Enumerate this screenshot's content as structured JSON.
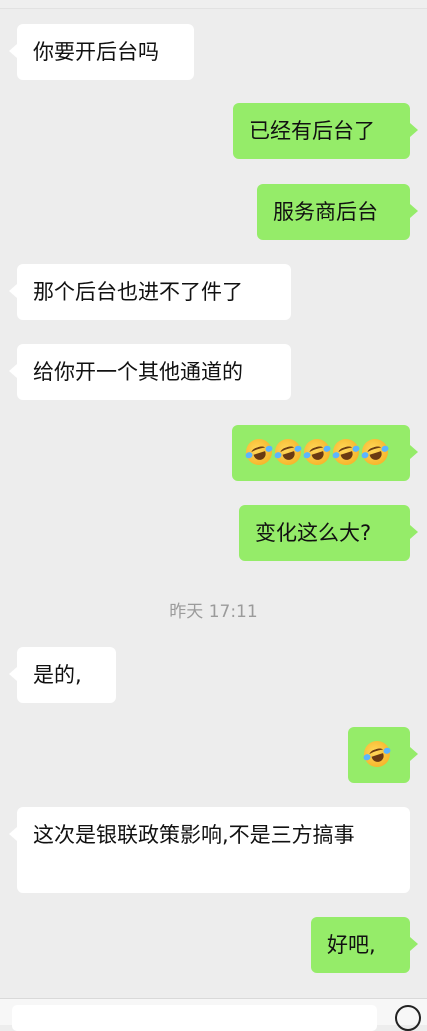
{
  "messages": [
    {
      "side": "left",
      "text": "你要开后台吗"
    },
    {
      "side": "right",
      "text": "已经有后台了"
    },
    {
      "side": "right",
      "text": "服务商后台"
    },
    {
      "side": "left",
      "text": "那个后台也进不了件了"
    },
    {
      "side": "left",
      "text": "给你开一个其他通道的"
    },
    {
      "side": "right",
      "emoji": "rofl-emoji",
      "emoji_count": 5
    },
    {
      "side": "right",
      "text": "变化这么大?"
    },
    {
      "side": "left",
      "text": "是的,"
    },
    {
      "side": "right",
      "emoji": "rofl-emoji",
      "emoji_count": 1
    },
    {
      "side": "left",
      "text": "这次是银联政策影响,不是三方搞事"
    },
    {
      "side": "right",
      "text": "好吧,"
    }
  ],
  "timestamp": "昨天 17:11",
  "colors": {
    "background": "#ededed",
    "incoming_bubble": "#ffffff",
    "outgoing_bubble": "#95ec69",
    "timestamp_text": "#9b9b9b"
  },
  "icons": {
    "bottom_right": "voice-icon"
  }
}
